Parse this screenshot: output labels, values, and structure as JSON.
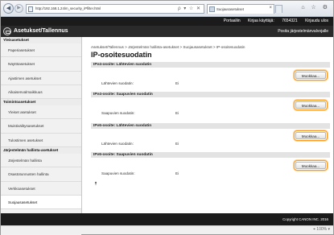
{
  "browser": {
    "url": "http://192.168.1.24/m_security_iPfilter.html",
    "address_icons": "ρ ▾ ☆ ✕",
    "back_glyph": "◀",
    "forward_glyph": "▶",
    "tab_title": "Suojausasetukset",
    "tab_close": "×",
    "window_tools": "⌂ ☆ ⚙"
  },
  "topbar": {
    "portal_link": "Portaaliin",
    "login_label": "Kirjaa käyttäjä:",
    "user": "7654321",
    "logout": "Kirjaudu ulos"
  },
  "header": {
    "title": "Asetukset/Tallennus",
    "portal_display": "Posita järjestelmänvalvojalle"
  },
  "sidebar": {
    "groups": [
      {
        "label": "Yleisasetukset",
        "items": [
          "Paperiasetukset",
          "Näyttöasetukset",
          "Ajastimen asetukset",
          "Aikaisenvalmaikkuus"
        ]
      },
      {
        "label": "Toimintoasetukset",
        "items": [
          "Yleiset asetukset",
          "Muistivälitysasetukset",
          "Tulostimen asetukset"
        ]
      },
      {
        "label": "Järjestelmän hallinta-asetukset",
        "items": [
          "Järjestelmän hallinta",
          "Osastotunnusten hallinta",
          "Verkkoasetukset",
          "Suojausasetukset",
          "Tuonti/Vienti",
          "Alustusasetusten tiedot"
        ]
      }
    ],
    "active": "Suojausasetukset"
  },
  "main": {
    "breadcrumb": "Asetukset/Tallennus > Järjestelmän hallinta-asetukset > Suojausasetukset > IP-osoitesuodatin",
    "title": "IP-osoitesuodatin",
    "sections": [
      {
        "header": "IPv4-osoite: Lähtevien suodatin",
        "label": "Lähtevien suodatin:",
        "value": "Ei",
        "button": "Muokkaa..."
      },
      {
        "header": "IPv4-osoite: Saapuvien suodatin",
        "label": "Saapuvien suodatin:",
        "value": "Ei",
        "button": "Muokkaa..."
      },
      {
        "header": "IPv6-osoite: Lähtevien suodatin",
        "label": "Lähtevien suodatin:",
        "value": "Ei",
        "button": "Muokkaa..."
      },
      {
        "header": "IPv6-osoite: Saapuvien suodatin",
        "label": "Saapuvien suodatin:",
        "value": "Ei",
        "button": "Muokkaa..."
      }
    ],
    "top_link": "⯭"
  },
  "footer": {
    "copyright": "Copyright CANON INC. 2016"
  },
  "statusbar": {
    "zoom": "⌖ 100% ▾"
  },
  "colors": {
    "header_bg": "#2a2a2a",
    "topbar_bg": "#1b1b1b",
    "button_highlight": "#ff9a1a",
    "section_bg": "#e3e3e3"
  }
}
